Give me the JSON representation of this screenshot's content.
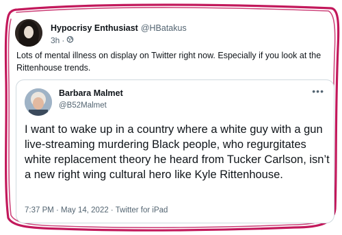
{
  "colors": {
    "accent_scribble": "#c2185b",
    "text_primary": "#0f1419",
    "text_secondary": "#536471",
    "border": "#cfd9de"
  },
  "post": {
    "author_name": "Hypocrisy Enthusiast",
    "author_handle": "@HBatakus",
    "time": "3h",
    "separator": "·",
    "audience_icon": "public-icon",
    "text": "Lots of mental illness on display on Twitter right now. Especially if you look at the Rittenhouse trends."
  },
  "quoted_tweet": {
    "author_name": "Barbara Malmet",
    "author_handle": "@B52Malmet",
    "more_label": "•••",
    "text": "I want to wake up in a country where a white guy with a gun live-streaming murdering Black people, who regurgitates white replacement theory he heard from Tucker Carlson, isn’t a new right wing cultural hero like Kyle Rittenhouse.",
    "timestamp": "7:37 PM · May 14, 2022 · Twitter for iPad"
  }
}
